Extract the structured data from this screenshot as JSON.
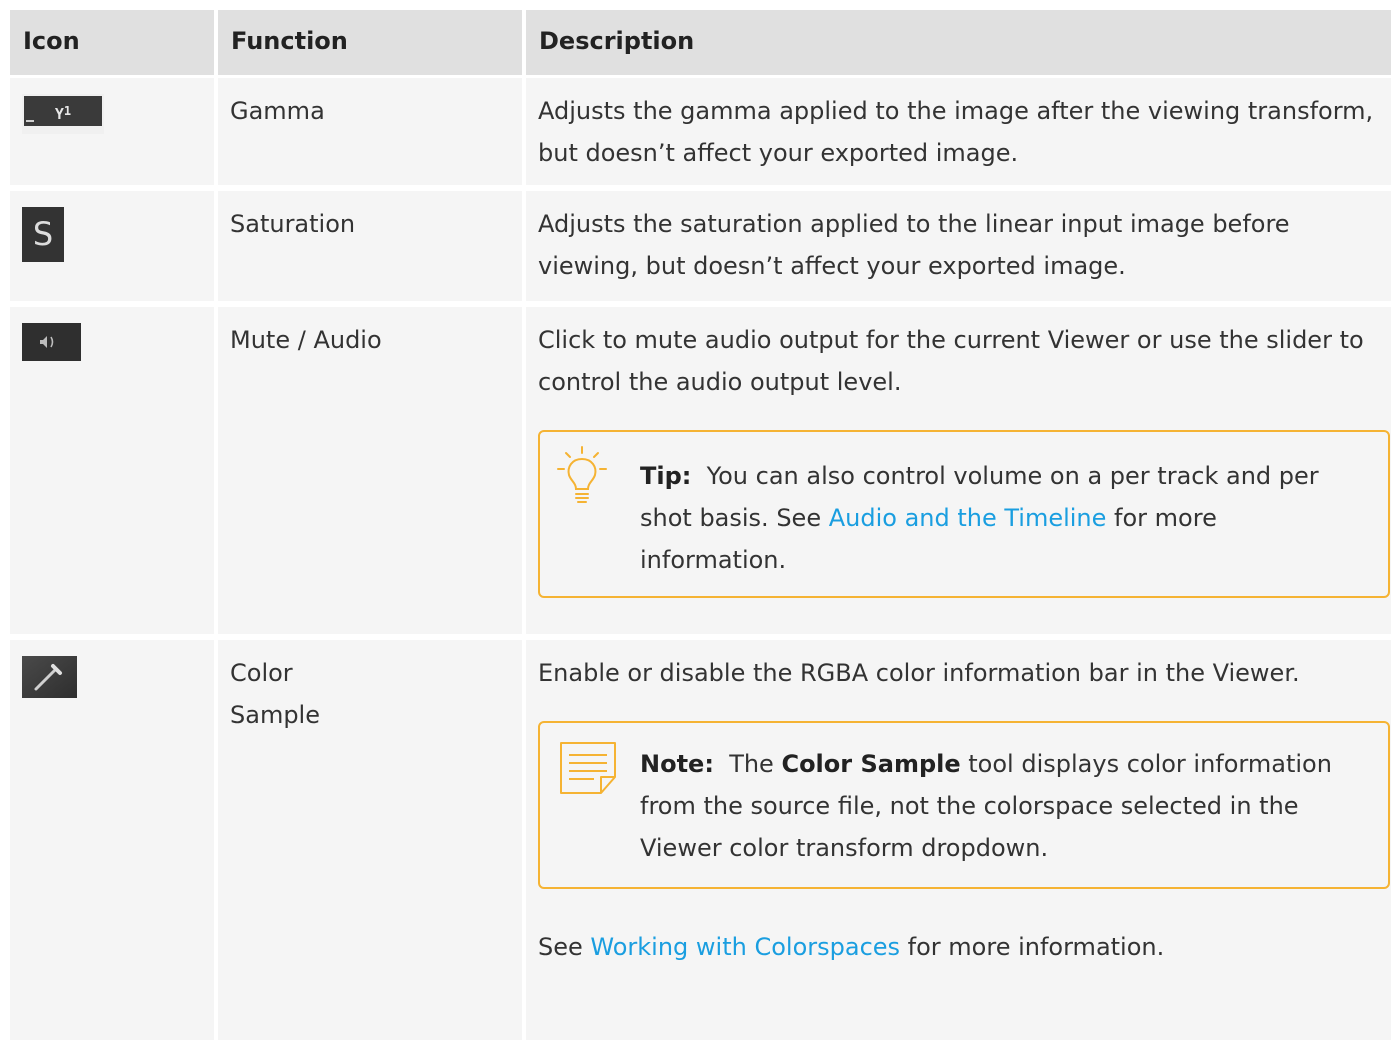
{
  "header": {
    "icon": "Icon",
    "function": "Function",
    "description": "Description"
  },
  "rows": [
    {
      "icon_name": "gamma-icon",
      "icon_text": "Y",
      "icon_sup": "1",
      "function": "Gamma",
      "description": "Adjusts the gamma applied to the image after the viewing transform, but doesn’t affect your exported image."
    },
    {
      "icon_name": "saturation-icon",
      "icon_text": "S",
      "function": "Saturation",
      "description": "Adjusts the saturation applied to the linear input image before viewing, but doesn’t affect your exported image."
    },
    {
      "icon_name": "audio-icon",
      "icon_text": "◀︎)",
      "function": "Mute / Audio",
      "description": "Click to mute audio output for the current Viewer or use the slider to control the audio output level.",
      "tip": {
        "label": "Tip:",
        "text_before": "You can also control volume on a per track and per shot basis. See ",
        "link": "Audio and the Timeline",
        "text_after": " for more information."
      }
    },
    {
      "icon_name": "color-picker-icon",
      "function": "Color Sample",
      "description": "Enable or disable the RGBA color information bar in the Viewer.",
      "note": {
        "label": "Note:",
        "text_before": "The ",
        "bold": "Color Sample",
        "text_after": " tool displays color information from the source file, not the colorspace selected in the Viewer color transform dropdown."
      },
      "see_before": "See ",
      "see_link": "Working with Colorspaces",
      "see_after": " for more information."
    }
  ],
  "colors": {
    "header_bg": "#e0e0e0",
    "row_bg": "#f5f5f5",
    "callout_border": "#f5b333",
    "link": "#1a9ee0"
  }
}
